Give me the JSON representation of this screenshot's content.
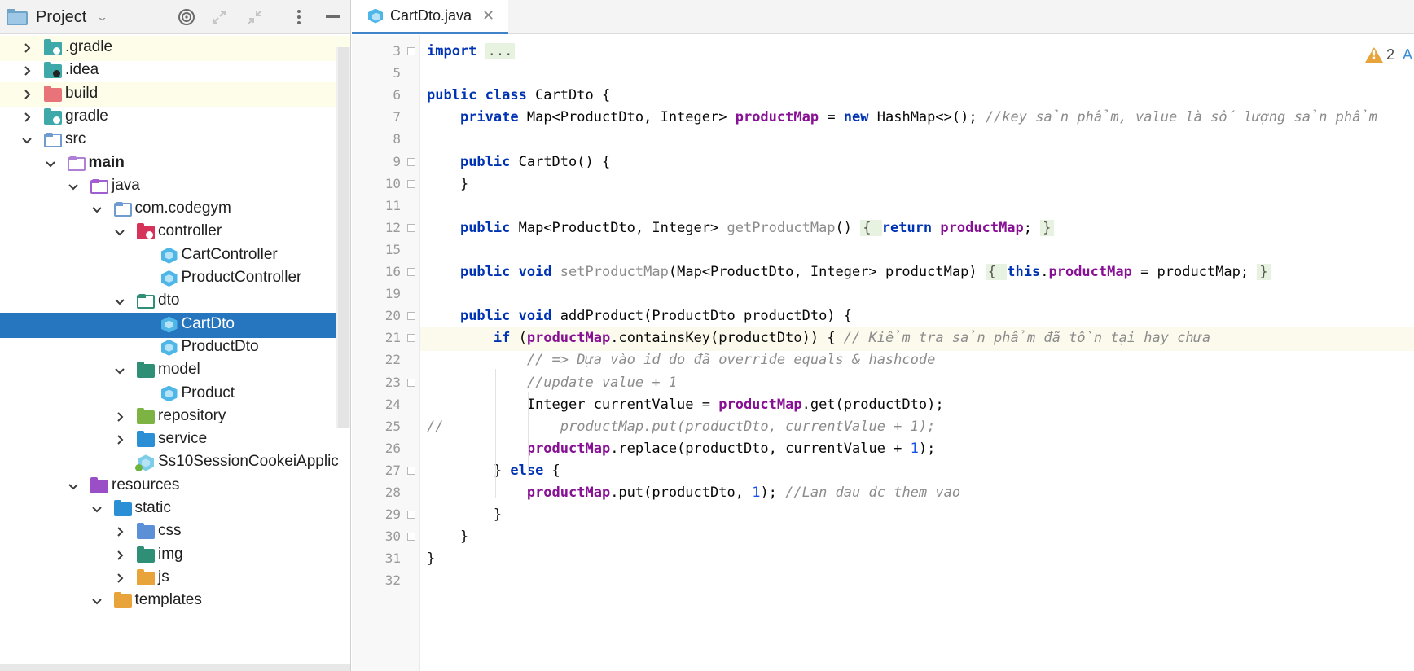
{
  "project_panel": {
    "title": "Project",
    "tree": [
      {
        "label": ".gradle",
        "depth": 0,
        "expander": "collapsed",
        "icon": "folder-teal-badge",
        "highlight": true
      },
      {
        "label": ".idea",
        "depth": 0,
        "expander": "collapsed",
        "icon": "folder-teal-idea",
        "highlight": false
      },
      {
        "label": "build",
        "depth": 0,
        "expander": "collapsed",
        "icon": "folder-red",
        "highlight": true
      },
      {
        "label": "gradle",
        "depth": 0,
        "expander": "collapsed",
        "icon": "folder-teal-badge",
        "highlight": false
      },
      {
        "label": "src",
        "depth": 0,
        "expander": "expanded",
        "icon": "folder-source",
        "highlight": false
      },
      {
        "label": "main",
        "depth": 1,
        "expander": "expanded",
        "icon": "folder-outline-purple",
        "highlight": false,
        "bold": true
      },
      {
        "label": "java",
        "depth": 2,
        "expander": "expanded",
        "icon": "folder-java-source",
        "highlight": false
      },
      {
        "label": "com.codegym",
        "depth": 3,
        "expander": "expanded",
        "icon": "folder-package",
        "highlight": false
      },
      {
        "label": "controller",
        "depth": 4,
        "expander": "expanded",
        "icon": "folder-controller",
        "highlight": false
      },
      {
        "label": "CartController",
        "depth": 5,
        "expander": "none",
        "icon": "class",
        "highlight": false
      },
      {
        "label": "ProductController",
        "depth": 5,
        "expander": "none",
        "icon": "class",
        "highlight": false
      },
      {
        "label": "dto",
        "depth": 4,
        "expander": "expanded",
        "icon": "folder-dto",
        "highlight": false
      },
      {
        "label": "CartDto",
        "depth": 5,
        "expander": "none",
        "icon": "class",
        "highlight": false,
        "selected": true
      },
      {
        "label": "ProductDto",
        "depth": 5,
        "expander": "none",
        "icon": "class",
        "highlight": false
      },
      {
        "label": "model",
        "depth": 4,
        "expander": "expanded",
        "icon": "folder-model",
        "highlight": false
      },
      {
        "label": "Product",
        "depth": 5,
        "expander": "none",
        "icon": "class",
        "highlight": false
      },
      {
        "label": "repository",
        "depth": 4,
        "expander": "collapsed",
        "icon": "folder-repository",
        "highlight": false
      },
      {
        "label": "service",
        "depth": 4,
        "expander": "collapsed",
        "icon": "folder-service",
        "highlight": false
      },
      {
        "label": "Ss10SessionCookeiApplic",
        "depth": 4,
        "expander": "none",
        "icon": "spring-app",
        "highlight": false
      },
      {
        "label": "resources",
        "depth": 2,
        "expander": "expanded",
        "icon": "folder-resources",
        "highlight": false
      },
      {
        "label": "static",
        "depth": 3,
        "expander": "expanded",
        "icon": "folder-web",
        "highlight": false
      },
      {
        "label": "css",
        "depth": 4,
        "expander": "collapsed",
        "icon": "folder-css",
        "highlight": false
      },
      {
        "label": "img",
        "depth": 4,
        "expander": "collapsed",
        "icon": "folder-img",
        "highlight": false
      },
      {
        "label": "js",
        "depth": 4,
        "expander": "collapsed",
        "icon": "folder-js",
        "highlight": false
      },
      {
        "label": "templates",
        "depth": 3,
        "expander": "expanded",
        "icon": "folder-templates",
        "highlight": false
      }
    ]
  },
  "editor": {
    "tab_label": "CartDto.java",
    "warning_count": "2",
    "warning_extra": "A",
    "current_line": "21",
    "lines": [
      {
        "n": "3",
        "fold": true,
        "parts": [
          [
            "kw",
            "import"
          ],
          [
            "",
            ""
          ],
          [
            "",
            " "
          ],
          [
            "foldtxt",
            "..."
          ]
        ]
      },
      {
        "n": "5",
        "parts": []
      },
      {
        "n": "6",
        "parts": [
          [
            "kw",
            "public class"
          ],
          [
            "",
            " CartDto {"
          ]
        ]
      },
      {
        "n": "7",
        "parts": [
          [
            "",
            "    "
          ],
          [
            "kw",
            "private"
          ],
          [
            "",
            " Map<ProductDto, Integer> "
          ],
          [
            "fld",
            "productMap"
          ],
          [
            "",
            " = "
          ],
          [
            "kw",
            "new"
          ],
          [
            "",
            " HashMap<>(); "
          ],
          [
            "cmt",
            "//key sản phẩm, value là số lượng sản phẩm"
          ]
        ]
      },
      {
        "n": "8",
        "parts": []
      },
      {
        "n": "9",
        "fold": true,
        "parts": [
          [
            "",
            "    "
          ],
          [
            "kw",
            "public"
          ],
          [
            "",
            " CartDto() {"
          ]
        ]
      },
      {
        "n": "10",
        "fold": true,
        "parts": [
          [
            "",
            "    }"
          ]
        ]
      },
      {
        "n": "11",
        "parts": []
      },
      {
        "n": "12",
        "fold": true,
        "parts": [
          [
            "",
            "    "
          ],
          [
            "kw",
            "public"
          ],
          [
            "",
            " Map<ProductDto, Integer> "
          ],
          [
            "unused",
            "getProductMap"
          ],
          [
            "",
            "() "
          ],
          [
            "foldtxt",
            "{ "
          ],
          [
            "kw",
            "return"
          ],
          [
            "",
            " "
          ],
          [
            "fld",
            "productMap"
          ],
          [
            "",
            "; "
          ],
          [
            "foldtxt",
            "}"
          ]
        ]
      },
      {
        "n": "15",
        "parts": []
      },
      {
        "n": "16",
        "fold": true,
        "parts": [
          [
            "",
            "    "
          ],
          [
            "kw",
            "public void"
          ],
          [
            "",
            " "
          ],
          [
            "unused",
            "setProductMap"
          ],
          [
            "",
            "(Map<ProductDto, Integer> productMap) "
          ],
          [
            "foldtxt",
            "{ "
          ],
          [
            "kw",
            "this"
          ],
          [
            "",
            "."
          ],
          [
            "fld",
            "productMap"
          ],
          [
            "",
            " = productMap; "
          ],
          [
            "foldtxt",
            "}"
          ]
        ]
      },
      {
        "n": "19",
        "parts": []
      },
      {
        "n": "20",
        "fold": true,
        "parts": [
          [
            "",
            "    "
          ],
          [
            "kw",
            "public void"
          ],
          [
            "",
            " addProduct(ProductDto productDto) {"
          ]
        ]
      },
      {
        "n": "21",
        "fold": true,
        "parts": [
          [
            "",
            "        "
          ],
          [
            "kw",
            "if"
          ],
          [
            "",
            " ("
          ],
          [
            "fld",
            "productMap"
          ],
          [
            "",
            ".containsKey(productDto)) { "
          ],
          [
            "cmt",
            "// Kiểm tra sản phẩm đã tồn tại hay chưa"
          ]
        ]
      },
      {
        "n": "22",
        "parts": [
          [
            "",
            "            "
          ],
          [
            "cmt",
            "// => Dựa vào id do đã override equals & hashcode"
          ]
        ]
      },
      {
        "n": "23",
        "fold": true,
        "parts": [
          [
            "",
            "            "
          ],
          [
            "cmt",
            "//update value + 1"
          ]
        ]
      },
      {
        "n": "24",
        "parts": [
          [
            "",
            "            Integer currentValue = "
          ],
          [
            "fld",
            "productMap"
          ],
          [
            "",
            ".get(productDto);"
          ]
        ]
      },
      {
        "n": "25",
        "parts": [
          [
            "cmt",
            "//"
          ],
          [
            "",
            "              "
          ],
          [
            "cmt",
            "productMap.put(productDto, currentValue + 1);"
          ]
        ]
      },
      {
        "n": "26",
        "parts": [
          [
            "",
            "            "
          ],
          [
            "fld",
            "productMap"
          ],
          [
            "",
            ".replace(productDto, currentValue + "
          ],
          [
            "num",
            "1"
          ],
          [
            "",
            ");"
          ]
        ]
      },
      {
        "n": "27",
        "fold": true,
        "parts": [
          [
            "",
            "        } "
          ],
          [
            "kw",
            "else"
          ],
          [
            "",
            " {"
          ]
        ]
      },
      {
        "n": "28",
        "parts": [
          [
            "",
            "            "
          ],
          [
            "fld",
            "productMap"
          ],
          [
            "",
            ".put(productDto, "
          ],
          [
            "num",
            "1"
          ],
          [
            "",
            "); "
          ],
          [
            "cmt",
            "//Lan dau dc them vao"
          ]
        ]
      },
      {
        "n": "29",
        "fold": true,
        "parts": [
          [
            "",
            "        }"
          ]
        ]
      },
      {
        "n": "30",
        "fold": true,
        "parts": [
          [
            "",
            "    }"
          ]
        ]
      },
      {
        "n": "31",
        "parts": [
          [
            "",
            "}"
          ]
        ]
      },
      {
        "n": "32",
        "parts": []
      }
    ]
  },
  "icons": {
    "header_locate": "target-icon",
    "header_expand": "expand-all-icon",
    "header_collapse": "collapse-all-icon",
    "header_more": "more-vertical-icon",
    "header_hide": "minimize-icon",
    "tab_close": "close-icon",
    "warning": "warning-icon"
  },
  "colors": {
    "selection": "#2675bf",
    "keyword": "#0033b3",
    "field": "#871094",
    "comment": "#8c8c8c",
    "number": "#1750eb",
    "highlight_row": "#fdfde9",
    "current_line": "#fcfaed"
  }
}
